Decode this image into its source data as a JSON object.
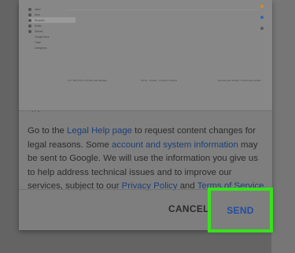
{
  "screenshot_preview": {
    "menu": [
      {
        "label": "Inbox",
        "kind": "item"
      },
      {
        "label": "Sent",
        "kind": "item"
      },
      {
        "label": "Snoozed",
        "kind": "item",
        "selected": true
      },
      {
        "label": "Drafts",
        "kind": "item"
      },
      {
        "label": "Starred",
        "kind": "item"
      },
      {
        "label": "Google Drive",
        "kind": "sub"
      },
      {
        "label": "Trash",
        "kind": "sub"
      },
      {
        "label": "Categories",
        "kind": "sub"
      }
    ],
    "footer_left": "0.17 GB (1%) of 15 GB used  Manage",
    "footer_middle": "Terms · Privacy · Program Policies",
    "footer_right": "Last account activity: 2 hours ago  Details",
    "colors": {
      "accent_orange": "#d08a2b",
      "accent_blue": "#3a63a8"
    }
  },
  "legal_notice": {
    "part1": "Go to the ",
    "link_legal_help": "Legal Help page",
    "part2": " to request content changes for legal reasons. Some ",
    "link_account_info": "account and system information",
    "part3": " may be sent to Google. We will use the information you give us to help address technical issues and to improve our services, subject to our ",
    "link_privacy": "Privacy Policy",
    "part4": " and ",
    "link_terms": "Terms of Service",
    "part5": "."
  },
  "actions": {
    "cancel_label": "CANCEL",
    "send_label": "SEND",
    "highlight_color": "#36e21a"
  }
}
